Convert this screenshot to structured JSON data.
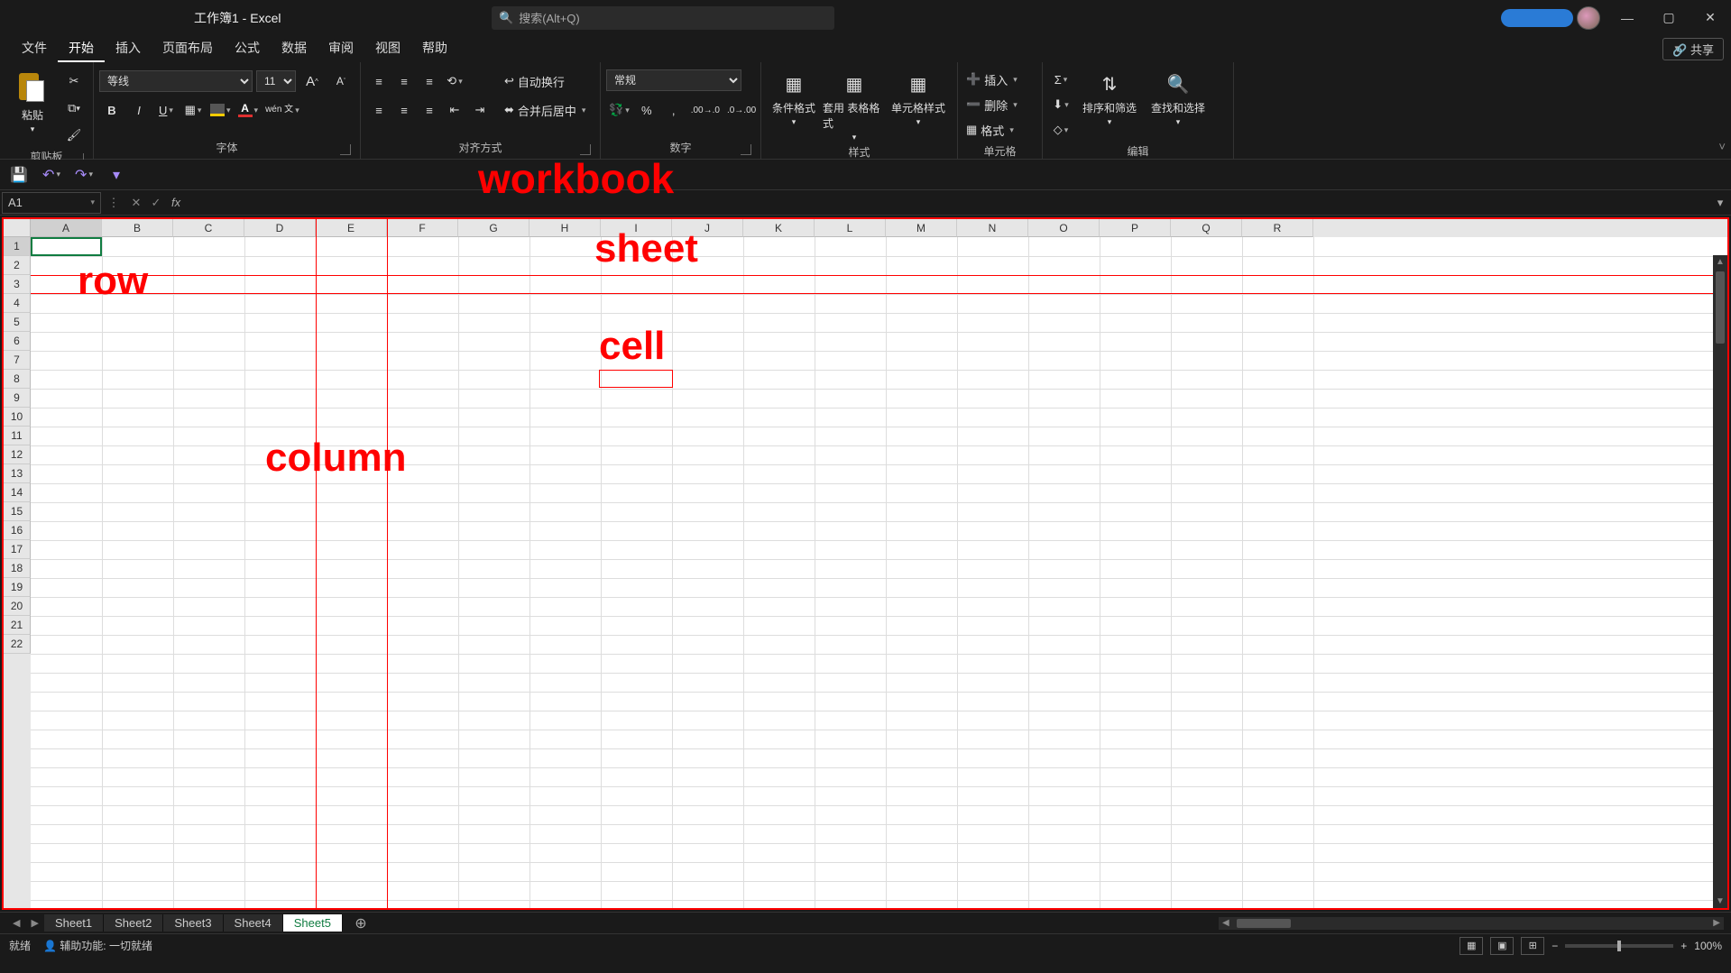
{
  "title": "工作簿1  -  Excel",
  "search_placeholder": "搜索(Alt+Q)",
  "window": {
    "min": "—",
    "max": "▢",
    "close": "✕"
  },
  "menu_tabs": [
    "文件",
    "开始",
    "插入",
    "页面布局",
    "公式",
    "数据",
    "审阅",
    "视图",
    "帮助"
  ],
  "active_menu_tab": "开始",
  "share_label": "共享",
  "ribbon": {
    "clipboard": {
      "paste": "粘贴",
      "label": "剪贴板"
    },
    "font": {
      "name": "等线",
      "size": "11",
      "bold": "B",
      "italic": "I",
      "underline": "U",
      "increase": "A",
      "decrease": "A",
      "wen": "wén 文",
      "label": "字体"
    },
    "align": {
      "wrap": "自动换行",
      "merge": "合并后居中",
      "label": "对齐方式"
    },
    "number": {
      "format": "常规",
      "label": "数字"
    },
    "styles": {
      "cond": "条件格式",
      "table": "套用 表格格式",
      "cell": "单元格样式",
      "label": "样式"
    },
    "cells": {
      "insert": "插入",
      "delete": "删除",
      "format": "格式",
      "label": "单元格"
    },
    "editing": {
      "sort": "排序和筛选",
      "find": "查找和选择",
      "label": "编辑"
    }
  },
  "namebox": "A1",
  "columns": [
    "A",
    "B",
    "C",
    "D",
    "E",
    "F",
    "G",
    "H",
    "I",
    "J",
    "K",
    "L",
    "M",
    "N",
    "O",
    "P",
    "Q",
    "R"
  ],
  "rows": [
    "1",
    "2",
    "3",
    "4",
    "5",
    "6",
    "7",
    "8",
    "9",
    "10",
    "11",
    "12",
    "13",
    "14",
    "15",
    "16",
    "17",
    "18",
    "19",
    "20",
    "21",
    "22"
  ],
  "annotations": {
    "workbook": "workbook",
    "sheet": "sheet",
    "row": "row",
    "column": "column",
    "cell": "cell"
  },
  "sheet_tabs": [
    "Sheet1",
    "Sheet2",
    "Sheet3",
    "Sheet4",
    "Sheet5"
  ],
  "active_sheet": "Sheet5",
  "status": {
    "ready": "就绪",
    "access": "辅助功能: 一切就绪",
    "zoom": "100%"
  }
}
